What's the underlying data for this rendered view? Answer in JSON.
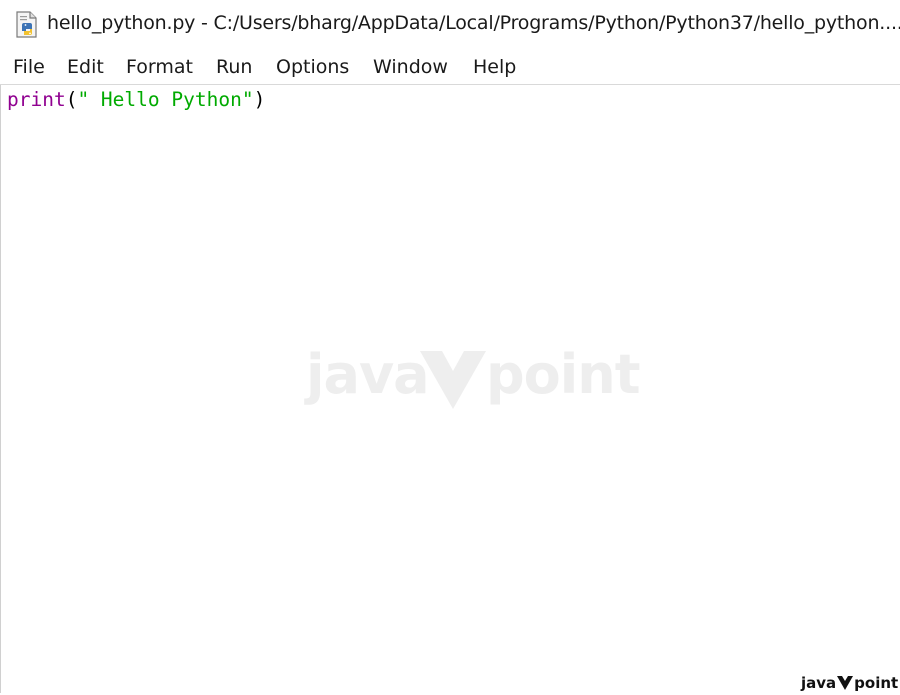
{
  "window": {
    "title": "hello_python.py - C:/Users/bharg/AppData/Local/Programs/Python/Python37/hello_python....",
    "icon": "python-file-icon"
  },
  "menubar": {
    "items": [
      {
        "label": "File"
      },
      {
        "label": "Edit"
      },
      {
        "label": "Format"
      },
      {
        "label": "Run"
      },
      {
        "label": "Options"
      },
      {
        "label": "Window"
      },
      {
        "label": "Help"
      }
    ]
  },
  "editor": {
    "lines": [
      {
        "tokens": [
          {
            "text": "print",
            "kind": "builtin"
          },
          {
            "text": "(",
            "kind": "paren"
          },
          {
            "text": "\" Hello Python\"",
            "kind": "string"
          },
          {
            "text": ")",
            "kind": "paren"
          }
        ]
      }
    ]
  },
  "watermark": {
    "left": "java",
    "right": "point"
  },
  "corner_logo": {
    "left": "java",
    "right": "point"
  },
  "colors": {
    "builtin": "#900090",
    "string": "#00aa00",
    "text": "#1a1a1a"
  }
}
